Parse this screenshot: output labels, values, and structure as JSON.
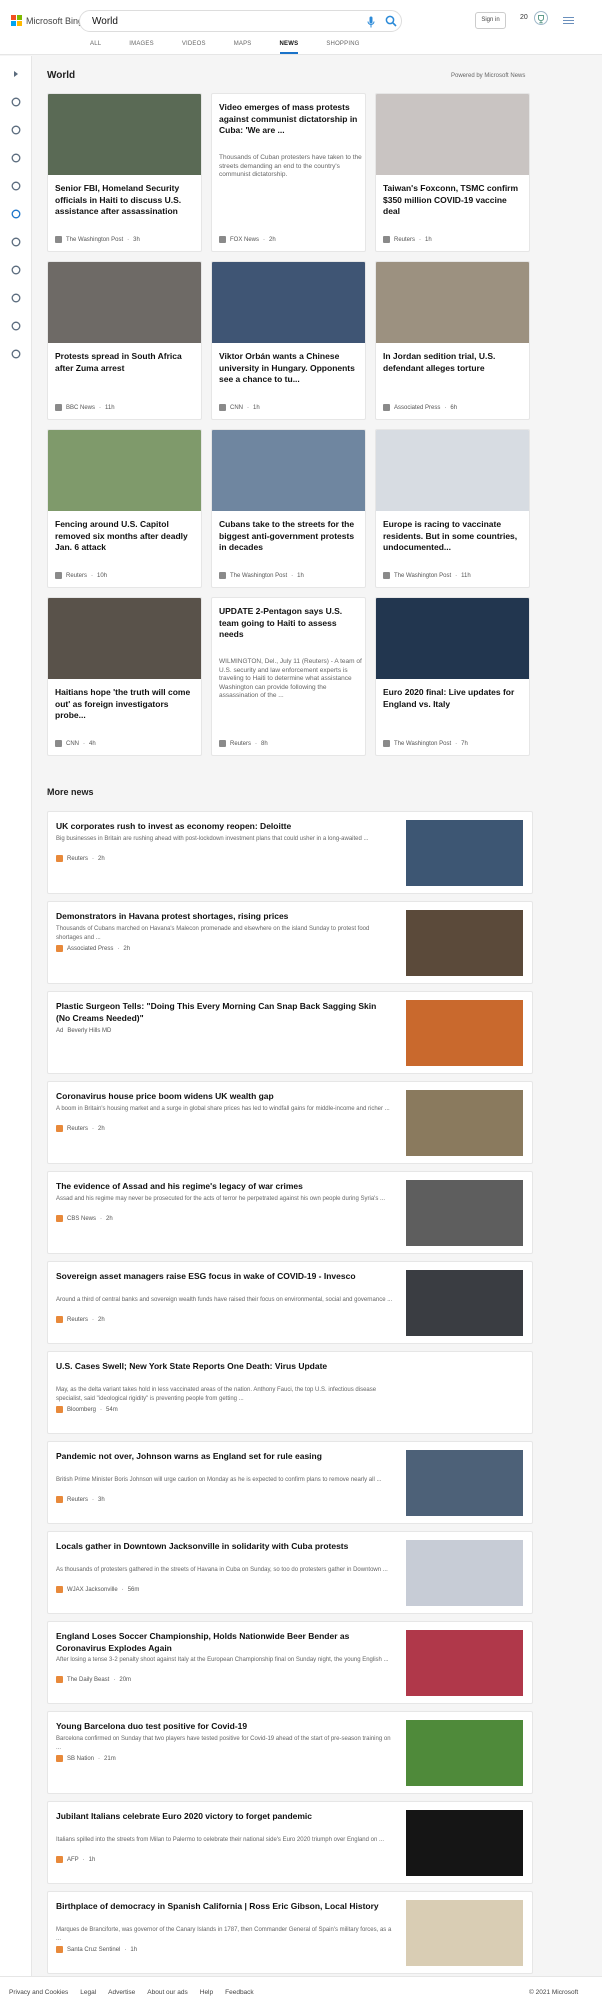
{
  "brand": {
    "name": "Microsoft Bing"
  },
  "search": {
    "query": "World"
  },
  "header": {
    "sign_in": "Sign in",
    "rewards_count": "20"
  },
  "tabs": [
    {
      "label": "ALL"
    },
    {
      "label": "IMAGES"
    },
    {
      "label": "VIDEOS"
    },
    {
      "label": "MAPS"
    },
    {
      "label": "NEWS"
    },
    {
      "label": "SHOPPING"
    }
  ],
  "section": {
    "title": "World",
    "powered_by": "Powered by Microsoft News"
  },
  "sidebar_icons": [
    "expand-icon",
    "home-icon",
    "sports-icon",
    "flag-icon",
    "location-icon",
    "globe-icon",
    "science-icon",
    "rocket-icon",
    "entertainment-icon",
    "politics-icon",
    "business-icon"
  ],
  "cards": [
    {
      "title": "Senior FBI, Homeland Security officials in Haiti to discuss U.S. assistance after assassination",
      "desc": "",
      "source": "The Washington Post",
      "time": "3h",
      "color": "#5a6a55"
    },
    {
      "title": "Video emerges of mass protests against communist dictatorship in Cuba: 'We are ...",
      "desc": "Thousands of Cuban protesters have taken to the streets demanding an end to the country's communist dictatorship.",
      "source": "FOX News",
      "time": "2h",
      "color": ""
    },
    {
      "title": "Taiwan's Foxconn, TSMC confirm $350 million COVID-19 vaccine deal",
      "desc": "",
      "source": "Reuters",
      "time": "1h",
      "color": "#c9c4c2"
    },
    {
      "title": "Protests spread in South Africa after Zuma arrest",
      "desc": "",
      "source": "BBC News",
      "time": "11h",
      "color": "#6e6a66"
    },
    {
      "title": "Viktor Orbán wants a Chinese university in Hungary. Opponents see a chance to tu...",
      "desc": "",
      "source": "CNN",
      "time": "1h",
      "color": "#3f5574"
    },
    {
      "title": "In Jordan sedition trial, U.S. defendant alleges torture",
      "desc": "",
      "source": "Associated Press",
      "time": "6h",
      "color": "#9c9180"
    },
    {
      "title": "Fencing around U.S. Capitol removed six months after deadly Jan. 6 attack",
      "desc": "",
      "source": "Reuters",
      "time": "10h",
      "color": "#7f9a6b"
    },
    {
      "title": "Cubans take to the streets for the biggest anti-government protests in decades",
      "desc": "",
      "source": "The Washington Post",
      "time": "1h",
      "color": "#6f86a0"
    },
    {
      "title": "Europe is racing to vaccinate residents. But in some countries, undocumented...",
      "desc": "",
      "source": "The Washington Post",
      "time": "11h",
      "color": "#d7dce2"
    },
    {
      "title": "Haitians hope 'the truth will come out' as foreign investigators probe...",
      "desc": "",
      "source": "CNN",
      "time": "4h",
      "color": "#59524a"
    },
    {
      "title": "UPDATE 2-Pentagon says U.S. team going to Haiti to assess needs",
      "desc": "WILMINGTON, Del., July 11 (Reuters) - A team of U.S. security and law enforcement experts is traveling to Haiti to determine what assistance Washington can provide following the assassination of the ...",
      "source": "Reuters",
      "time": "8h",
      "color": ""
    },
    {
      "title": "Euro 2020 final: Live updates for England vs. Italy",
      "desc": "",
      "source": "The Washington Post",
      "time": "7h",
      "color": "#22364f"
    }
  ],
  "more_news": {
    "title": "More news"
  },
  "rows": [
    {
      "title": "UK corporates rush to invest as economy reopen: Deloitte",
      "desc": "Big businesses in Britain are rushing ahead with post-lockdown investment plans that could usher in a long-awaited ...",
      "source": "Reuters",
      "time": "2h",
      "color": "#3d5673"
    },
    {
      "title": "Demonstrators in Havana protest shortages, rising prices",
      "desc": "Thousands of Cubans marched on Havana's Malecon promenade and elsewhere on the island Sunday to protest food shortages and ...",
      "source": "Associated Press",
      "time": "2h",
      "color": "#5b4a3a"
    },
    {
      "title": "Plastic Surgeon Tells: \"Doing This Every Morning Can Snap Back Sagging Skin (No Creams Needed)\"",
      "desc": "",
      "source": "Beverly Hills MD",
      "time": "",
      "ad": "Ad",
      "color": "#c9692d"
    },
    {
      "title": "Coronavirus house price boom widens UK wealth gap",
      "desc": "A boom in Britain's housing market and a surge in global share prices has led to windfall gains for middle-income and richer ...",
      "source": "Reuters",
      "time": "2h",
      "color": "#8a7a5e"
    },
    {
      "title": "The evidence of Assad and his regime's legacy of war crimes",
      "desc": "Assad and his regime may never be prosecuted for the acts of terror he perpetrated against his own people during Syria's ...",
      "source": "CBS News",
      "time": "2h",
      "color": "#5e5e5e"
    },
    {
      "title": "Sovereign asset managers raise ESG focus in wake of COVID-19 - Invesco",
      "desc": "Around a third of central banks and sovereign wealth funds have raised their focus on environmental, social and governance ...",
      "source": "Reuters",
      "time": "2h",
      "color": "#3a3d42"
    },
    {
      "title": "U.S. Cases Swell; New York State Reports One Death: Virus Update",
      "desc": "May, as the delta variant takes hold in less vaccinated areas of the nation. Anthony Fauci, the top U.S. infectious disease specialist, said \"ideological rigidity\" is preventing people from getting ...",
      "source": "Bloomberg",
      "time": "54m",
      "color": ""
    },
    {
      "title": "Pandemic not over, Johnson warns as England set for rule easing",
      "desc": "British Prime Minister Boris Johnson will urge caution on Monday as he is expected to confirm plans to remove nearly all ...",
      "source": "Reuters",
      "time": "3h",
      "color": "#4d6178"
    },
    {
      "title": "Locals gather in Downtown Jacksonville in solidarity with Cuba protests",
      "desc": "As thousands of protesters gathered in the streets of Havana in Cuba on Sunday, so too do protesters gather in Downtown ...",
      "source": "WJAX Jacksonville",
      "time": "56m",
      "color": "#c7ccd6"
    },
    {
      "title": "England Loses Soccer Championship, Holds Nationwide Beer Bender as Coronavirus Explodes Again",
      "desc": "After losing a tense 3-2 penalty shoot against Italy at the European Championship final on Sunday night, the young English ...",
      "source": "The Daily Beast",
      "time": "20m",
      "color": "#b0384a"
    },
    {
      "title": "Young Barcelona duo test positive for Covid-19",
      "desc": "Barcelona confirmed on Sunday that two players have tested positive for Covid-19 ahead of the start of pre-season training on ...",
      "source": "SB Nation",
      "time": "21m",
      "color": "#4f8a3a"
    },
    {
      "title": "Jubilant Italians celebrate Euro 2020 victory to forget pandemic",
      "desc": "Italians spilled into the streets from Milan to Palermo to celebrate their national side's Euro 2020 triumph over England on ...",
      "source": "AFP",
      "time": "1h",
      "color": "#151515"
    },
    {
      "title": "Birthplace of democracy in Spanish California | Ross Eric Gibson, Local History",
      "desc": "Marques de Branciforte, was governor of the Canary Islands in 1787, then Commander General of Spain's military forces, as a ...",
      "source": "Santa Cruz Sentinel",
      "time": "1h",
      "color": "#d9cdb4"
    }
  ],
  "footer": {
    "links": [
      "Privacy and Cookies",
      "Legal",
      "Advertise",
      "About our ads",
      "Help",
      "Feedback"
    ],
    "copyright": "© 2021 Microsoft"
  }
}
